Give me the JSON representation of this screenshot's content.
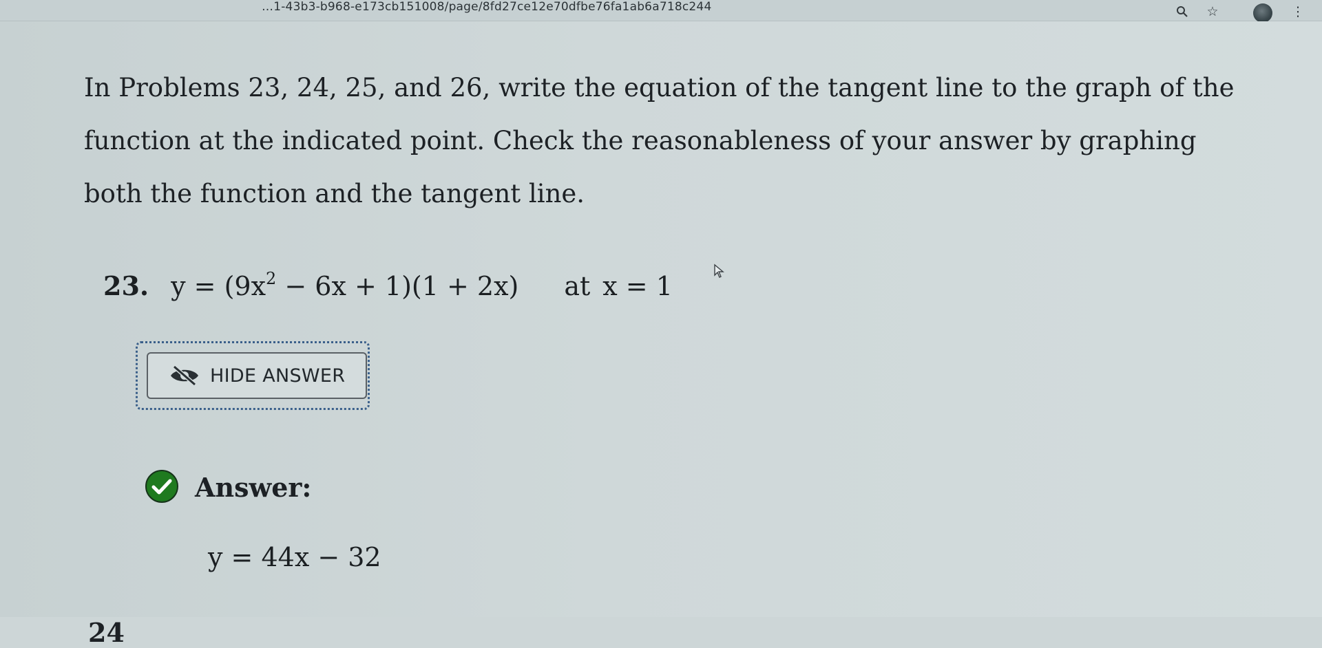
{
  "browser": {
    "url": "…1-43b3-b968-e173cb151008/page/8fd27ce12e70dfbe76fa1ab6a718c244",
    "icons": [
      "zoom-icon",
      "star-icon",
      "avatar",
      "menu-icon"
    ],
    "menu_glyph": "⋮",
    "zoom_glyph": "🔍",
    "star_glyph": "☆"
  },
  "content": {
    "intro": "In Problems 23, 24, 25, and 26, write the equation of the tangent line to the graph of the function at the indicated point. Check the reasonableness of your answer by graphing both the function and the tangent line.",
    "problem": {
      "number": "23.",
      "equation_prefix": "y = (9x",
      "exponent": "2",
      "equation_suffix": " − 6x + 1)(1 + 2x)",
      "at_label": "at",
      "condition": "x = 1"
    },
    "hide_button": {
      "label": "HIDE ANSWER",
      "icon": "eye-slash-icon"
    },
    "answer": {
      "label": "Answer:",
      "value": "y = 44x − 32",
      "icon": "check-circle-icon",
      "icon_color": "#1f7a1f"
    },
    "next_problem_partial": "24"
  },
  "colors": {
    "background": "#cdd6d7",
    "focus_ring": "#3a5f8a",
    "text": "#1d2125"
  }
}
